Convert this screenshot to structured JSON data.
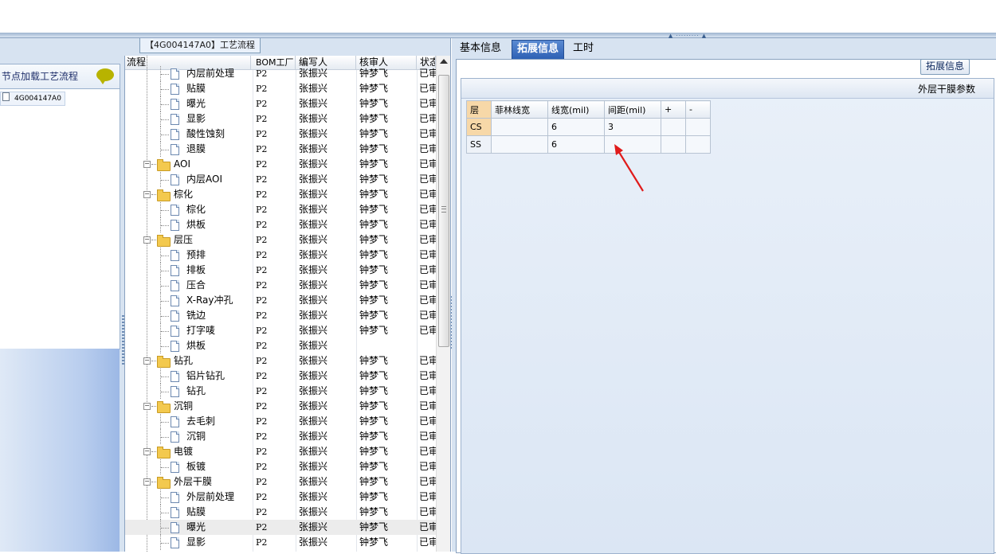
{
  "left_panel": {
    "title": "【4G004147A0】工艺流程",
    "list_header": "节点加载工艺流程",
    "node_label": "4G004147A0"
  },
  "tree_grid": {
    "columns": [
      "流程",
      "BOM工厂",
      "编写人",
      "核审人",
      "状态"
    ],
    "rows": [
      {
        "depth": 1,
        "type": "doc",
        "name": "内层前处理",
        "factory": "P2",
        "author": "张振兴",
        "reviewer": "钟梦飞",
        "status": "已审"
      },
      {
        "depth": 1,
        "type": "doc",
        "name": "贴膜",
        "factory": "P2",
        "author": "张振兴",
        "reviewer": "钟梦飞",
        "status": "已审"
      },
      {
        "depth": 1,
        "type": "doc",
        "name": "曝光",
        "factory": "P2",
        "author": "张振兴",
        "reviewer": "钟梦飞",
        "status": "已审"
      },
      {
        "depth": 1,
        "type": "doc",
        "name": "显影",
        "factory": "P2",
        "author": "张振兴",
        "reviewer": "钟梦飞",
        "status": "已审"
      },
      {
        "depth": 1,
        "type": "doc",
        "name": "酸性蚀刻",
        "factory": "P2",
        "author": "张振兴",
        "reviewer": "钟梦飞",
        "status": "已审"
      },
      {
        "depth": 1,
        "type": "doc",
        "name": "退膜",
        "factory": "P2",
        "author": "张振兴",
        "reviewer": "钟梦飞",
        "status": "已审"
      },
      {
        "depth": 0,
        "type": "folder",
        "name": "AOI",
        "factory": "P2",
        "author": "张振兴",
        "reviewer": "钟梦飞",
        "status": "已审"
      },
      {
        "depth": 1,
        "type": "doc",
        "name": "内层AOI",
        "factory": "P2",
        "author": "张振兴",
        "reviewer": "钟梦飞",
        "status": "已审"
      },
      {
        "depth": 0,
        "type": "folder",
        "name": "棕化",
        "factory": "P2",
        "author": "张振兴",
        "reviewer": "钟梦飞",
        "status": "已审"
      },
      {
        "depth": 1,
        "type": "doc",
        "name": "棕化",
        "factory": "P2",
        "author": "张振兴",
        "reviewer": "钟梦飞",
        "status": "已审"
      },
      {
        "depth": 1,
        "type": "doc",
        "name": "烘板",
        "factory": "P2",
        "author": "张振兴",
        "reviewer": "钟梦飞",
        "status": "已审"
      },
      {
        "depth": 0,
        "type": "folder",
        "name": "层压",
        "factory": "P2",
        "author": "张振兴",
        "reviewer": "钟梦飞",
        "status": "已审"
      },
      {
        "depth": 1,
        "type": "doc",
        "name": "预排",
        "factory": "P2",
        "author": "张振兴",
        "reviewer": "钟梦飞",
        "status": "已审"
      },
      {
        "depth": 1,
        "type": "doc",
        "name": "排板",
        "factory": "P2",
        "author": "张振兴",
        "reviewer": "钟梦飞",
        "status": "已审"
      },
      {
        "depth": 1,
        "type": "doc",
        "name": "压合",
        "factory": "P2",
        "author": "张振兴",
        "reviewer": "钟梦飞",
        "status": "已审"
      },
      {
        "depth": 1,
        "type": "doc",
        "name": "X-Ray冲孔",
        "factory": "P2",
        "author": "张振兴",
        "reviewer": "钟梦飞",
        "status": "已审"
      },
      {
        "depth": 1,
        "type": "doc",
        "name": "铣边",
        "factory": "P2",
        "author": "张振兴",
        "reviewer": "钟梦飞",
        "status": "已审"
      },
      {
        "depth": 1,
        "type": "doc",
        "name": "打字唛",
        "factory": "P2",
        "author": "张振兴",
        "reviewer": "钟梦飞",
        "status": "已审"
      },
      {
        "depth": 1,
        "type": "doc",
        "name": "烘板",
        "factory": "P2",
        "author": "张振兴",
        "reviewer": "",
        "status": ""
      },
      {
        "depth": 0,
        "type": "folder",
        "name": "钻孔",
        "factory": "P2",
        "author": "张振兴",
        "reviewer": "钟梦飞",
        "status": "已审"
      },
      {
        "depth": 1,
        "type": "doc",
        "name": "铝片钻孔",
        "factory": "P2",
        "author": "张振兴",
        "reviewer": "钟梦飞",
        "status": "已审"
      },
      {
        "depth": 1,
        "type": "doc",
        "name": "钻孔",
        "factory": "P2",
        "author": "张振兴",
        "reviewer": "钟梦飞",
        "status": "已审"
      },
      {
        "depth": 0,
        "type": "folder",
        "name": "沉铜",
        "factory": "P2",
        "author": "张振兴",
        "reviewer": "钟梦飞",
        "status": "已审"
      },
      {
        "depth": 1,
        "type": "doc",
        "name": "去毛刺",
        "factory": "P2",
        "author": "张振兴",
        "reviewer": "钟梦飞",
        "status": "已审"
      },
      {
        "depth": 1,
        "type": "doc",
        "name": "沉铜",
        "factory": "P2",
        "author": "张振兴",
        "reviewer": "钟梦飞",
        "status": "已审"
      },
      {
        "depth": 0,
        "type": "folder",
        "name": "电镀",
        "factory": "P2",
        "author": "张振兴",
        "reviewer": "钟梦飞",
        "status": "已审"
      },
      {
        "depth": 1,
        "type": "doc",
        "name": "板镀",
        "factory": "P2",
        "author": "张振兴",
        "reviewer": "钟梦飞",
        "status": "已审"
      },
      {
        "depth": 0,
        "type": "folder",
        "name": "外层干膜",
        "factory": "P2",
        "author": "张振兴",
        "reviewer": "钟梦飞",
        "status": "已审"
      },
      {
        "depth": 1,
        "type": "doc",
        "name": "外层前处理",
        "factory": "P2",
        "author": "张振兴",
        "reviewer": "钟梦飞",
        "status": "已审"
      },
      {
        "depth": 1,
        "type": "doc",
        "name": "贴膜",
        "factory": "P2",
        "author": "张振兴",
        "reviewer": "钟梦飞",
        "status": "已审"
      },
      {
        "depth": 1,
        "type": "doc",
        "name": "曝光",
        "factory": "P2",
        "author": "张振兴",
        "reviewer": "钟梦飞",
        "status": "已审",
        "selected": true
      },
      {
        "depth": 1,
        "type": "doc",
        "name": "显影",
        "factory": "P2",
        "author": "张振兴",
        "reviewer": "钟梦飞",
        "status": "已审"
      }
    ]
  },
  "right_panel": {
    "tabs": [
      {
        "label": "基本信息",
        "active": false
      },
      {
        "label": "拓展信息",
        "active": true
      },
      {
        "label": "工时",
        "active": false
      }
    ],
    "extend_button": "拓展信息",
    "inner_title": "外层干膜参数",
    "table": {
      "headers": [
        "层",
        "菲林线宽",
        "线宽(mil)",
        "间距(mil)",
        "+",
        "-"
      ],
      "rows": [
        [
          "CS",
          "",
          "6",
          "3",
          "",
          ""
        ],
        [
          "SS",
          "",
          "6",
          "",
          "",
          ""
        ]
      ]
    }
  },
  "colors": {
    "accent_tab": "#2b5fb3",
    "panel_bg": "#d7e3f1",
    "arrow": "#e01b1b",
    "row_header": "#f7d8a8"
  }
}
